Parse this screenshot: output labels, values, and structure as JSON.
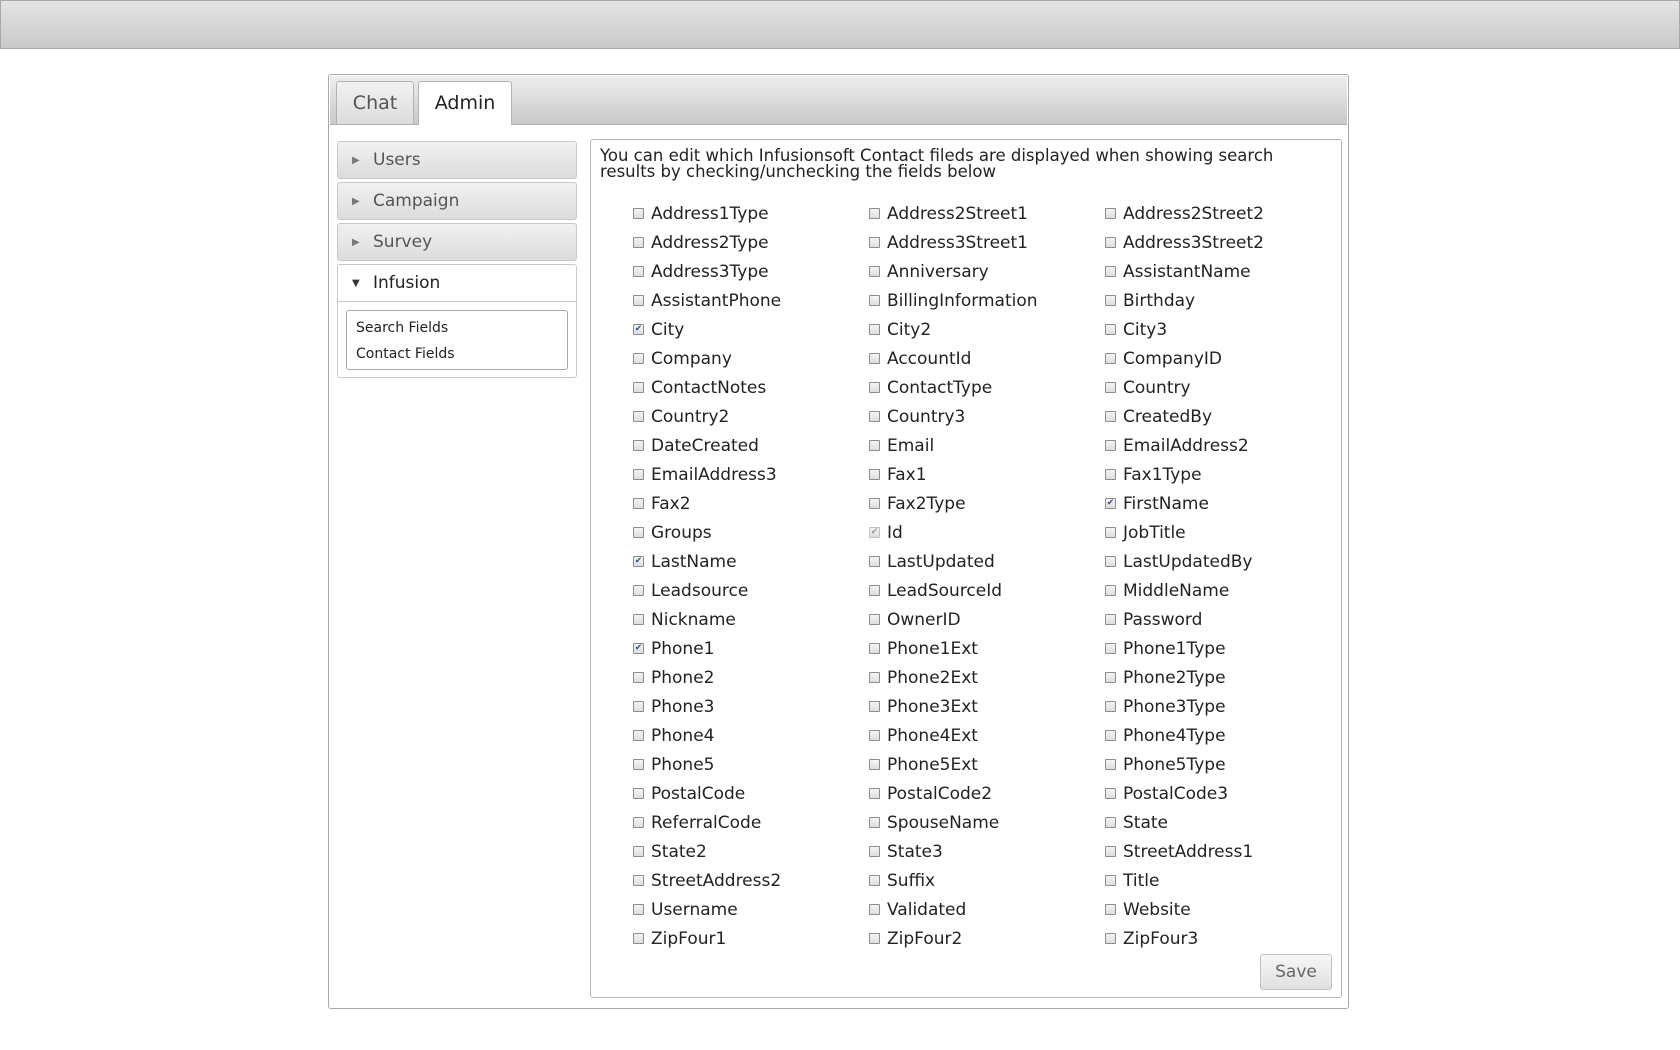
{
  "tabs": [
    {
      "label": "Chat",
      "active": false
    },
    {
      "label": "Admin",
      "active": true
    }
  ],
  "sidebar": {
    "sections": [
      {
        "label": "Users",
        "open": false
      },
      {
        "label": "Campaign",
        "open": false
      },
      {
        "label": "Survey",
        "open": false
      },
      {
        "label": "Infusion",
        "open": true
      }
    ],
    "submenu": [
      "Search Fields",
      "Contact Fields"
    ]
  },
  "main": {
    "intro_text": "You can edit which Infusionsoft Contact fileds are displayed when showing search results by checking/unchecking the fields below",
    "save_label": "Save",
    "fields": [
      {
        "name": "Address1Type",
        "checked": false
      },
      {
        "name": "Address2Street1",
        "checked": false
      },
      {
        "name": "Address2Street2",
        "checked": false
      },
      {
        "name": "Address2Type",
        "checked": false
      },
      {
        "name": "Address3Street1",
        "checked": false
      },
      {
        "name": "Address3Street2",
        "checked": false
      },
      {
        "name": "Address3Type",
        "checked": false
      },
      {
        "name": "Anniversary",
        "checked": false
      },
      {
        "name": "AssistantName",
        "checked": false
      },
      {
        "name": "AssistantPhone",
        "checked": false
      },
      {
        "name": "BillingInformation",
        "checked": false
      },
      {
        "name": "Birthday",
        "checked": false
      },
      {
        "name": "City",
        "checked": true
      },
      {
        "name": "City2",
        "checked": false
      },
      {
        "name": "City3",
        "checked": false
      },
      {
        "name": "Company",
        "checked": false
      },
      {
        "name": "AccountId",
        "checked": false
      },
      {
        "name": "CompanyID",
        "checked": false
      },
      {
        "name": "ContactNotes",
        "checked": false
      },
      {
        "name": "ContactType",
        "checked": false
      },
      {
        "name": "Country",
        "checked": false
      },
      {
        "name": "Country2",
        "checked": false
      },
      {
        "name": "Country3",
        "checked": false
      },
      {
        "name": "CreatedBy",
        "checked": false
      },
      {
        "name": "DateCreated",
        "checked": false
      },
      {
        "name": "Email",
        "checked": false
      },
      {
        "name": "EmailAddress2",
        "checked": false
      },
      {
        "name": "EmailAddress3",
        "checked": false
      },
      {
        "name": "Fax1",
        "checked": false
      },
      {
        "name": "Fax1Type",
        "checked": false
      },
      {
        "name": "Fax2",
        "checked": false
      },
      {
        "name": "Fax2Type",
        "checked": false
      },
      {
        "name": "FirstName",
        "checked": true
      },
      {
        "name": "Groups",
        "checked": false
      },
      {
        "name": "Id",
        "checked": true,
        "disabled": true
      },
      {
        "name": "JobTitle",
        "checked": false
      },
      {
        "name": "LastName",
        "checked": true
      },
      {
        "name": "LastUpdated",
        "checked": false
      },
      {
        "name": "LastUpdatedBy",
        "checked": false
      },
      {
        "name": "Leadsource",
        "checked": false
      },
      {
        "name": "LeadSourceId",
        "checked": false
      },
      {
        "name": "MiddleName",
        "checked": false
      },
      {
        "name": "Nickname",
        "checked": false
      },
      {
        "name": "OwnerID",
        "checked": false
      },
      {
        "name": "Password",
        "checked": false
      },
      {
        "name": "Phone1",
        "checked": true
      },
      {
        "name": "Phone1Ext",
        "checked": false
      },
      {
        "name": "Phone1Type",
        "checked": false
      },
      {
        "name": "Phone2",
        "checked": false
      },
      {
        "name": "Phone2Ext",
        "checked": false
      },
      {
        "name": "Phone2Type",
        "checked": false
      },
      {
        "name": "Phone3",
        "checked": false
      },
      {
        "name": "Phone3Ext",
        "checked": false
      },
      {
        "name": "Phone3Type",
        "checked": false
      },
      {
        "name": "Phone4",
        "checked": false
      },
      {
        "name": "Phone4Ext",
        "checked": false
      },
      {
        "name": "Phone4Type",
        "checked": false
      },
      {
        "name": "Phone5",
        "checked": false
      },
      {
        "name": "Phone5Ext",
        "checked": false
      },
      {
        "name": "Phone5Type",
        "checked": false
      },
      {
        "name": "PostalCode",
        "checked": false
      },
      {
        "name": "PostalCode2",
        "checked": false
      },
      {
        "name": "PostalCode3",
        "checked": false
      },
      {
        "name": "ReferralCode",
        "checked": false
      },
      {
        "name": "SpouseName",
        "checked": false
      },
      {
        "name": "State",
        "checked": false
      },
      {
        "name": "State2",
        "checked": false
      },
      {
        "name": "State3",
        "checked": false
      },
      {
        "name": "StreetAddress1",
        "checked": false
      },
      {
        "name": "StreetAddress2",
        "checked": false
      },
      {
        "name": "Suffix",
        "checked": false
      },
      {
        "name": "Title",
        "checked": false
      },
      {
        "name": "Username",
        "checked": false
      },
      {
        "name": "Validated",
        "checked": false
      },
      {
        "name": "Website",
        "checked": false
      },
      {
        "name": "ZipFour1",
        "checked": false
      },
      {
        "name": "ZipFour2",
        "checked": false
      },
      {
        "name": "ZipFour3",
        "checked": false
      }
    ]
  }
}
